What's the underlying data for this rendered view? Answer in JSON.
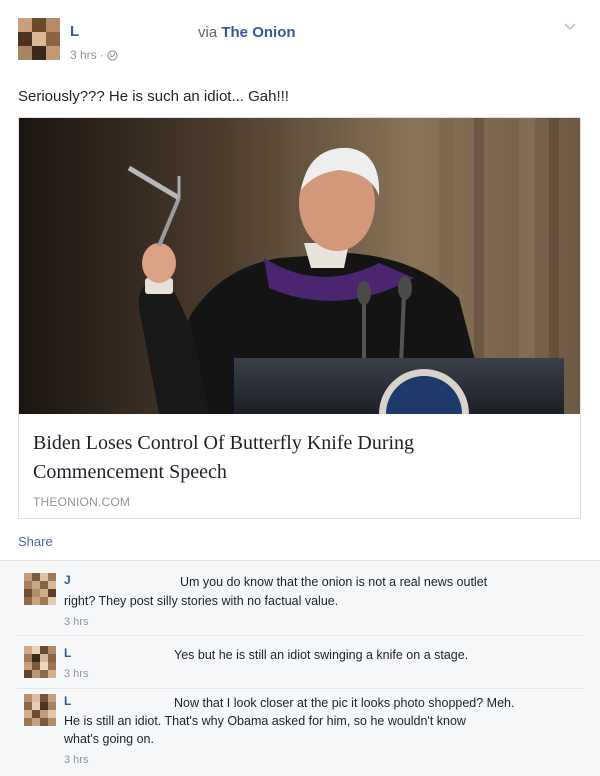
{
  "post": {
    "author": "L",
    "via_prefix": "via",
    "via_source": "The Onion",
    "timestamp": "3 hrs",
    "separator": "·",
    "text": "Seriously??? He is such an idiot... Gah!!!"
  },
  "card": {
    "headline_line1": "Biden Loses Control Of Butterfly Knife During",
    "headline_line2": "Commencement Speech",
    "domain": "THEONION.COM"
  },
  "actions": {
    "share": "Share"
  },
  "comments": [
    {
      "name": "J",
      "line1": "Um you do know that the onion is not a real news outlet",
      "line2": "right? They post silly stories with no factual value.",
      "time": "3 hrs"
    },
    {
      "name": "L",
      "line1": "Yes but he is still an idiot swinging a knife on a stage.",
      "time": "3 hrs"
    },
    {
      "name": "L",
      "line1": "Now that I look closer at the pic it looks photo shopped? Meh.",
      "line2": "He is still an idiot. That's why Obama asked for him, so he wouldn't know",
      "line3": "what's going on.",
      "time": "3 hrs"
    }
  ],
  "colors": {
    "link": "#365899",
    "meta": "#90949c",
    "text": "#1d2129",
    "comment_bg": "#f6f7f9"
  },
  "icons": {
    "globe": "globe-icon",
    "chevron": "chevron-down-icon"
  }
}
